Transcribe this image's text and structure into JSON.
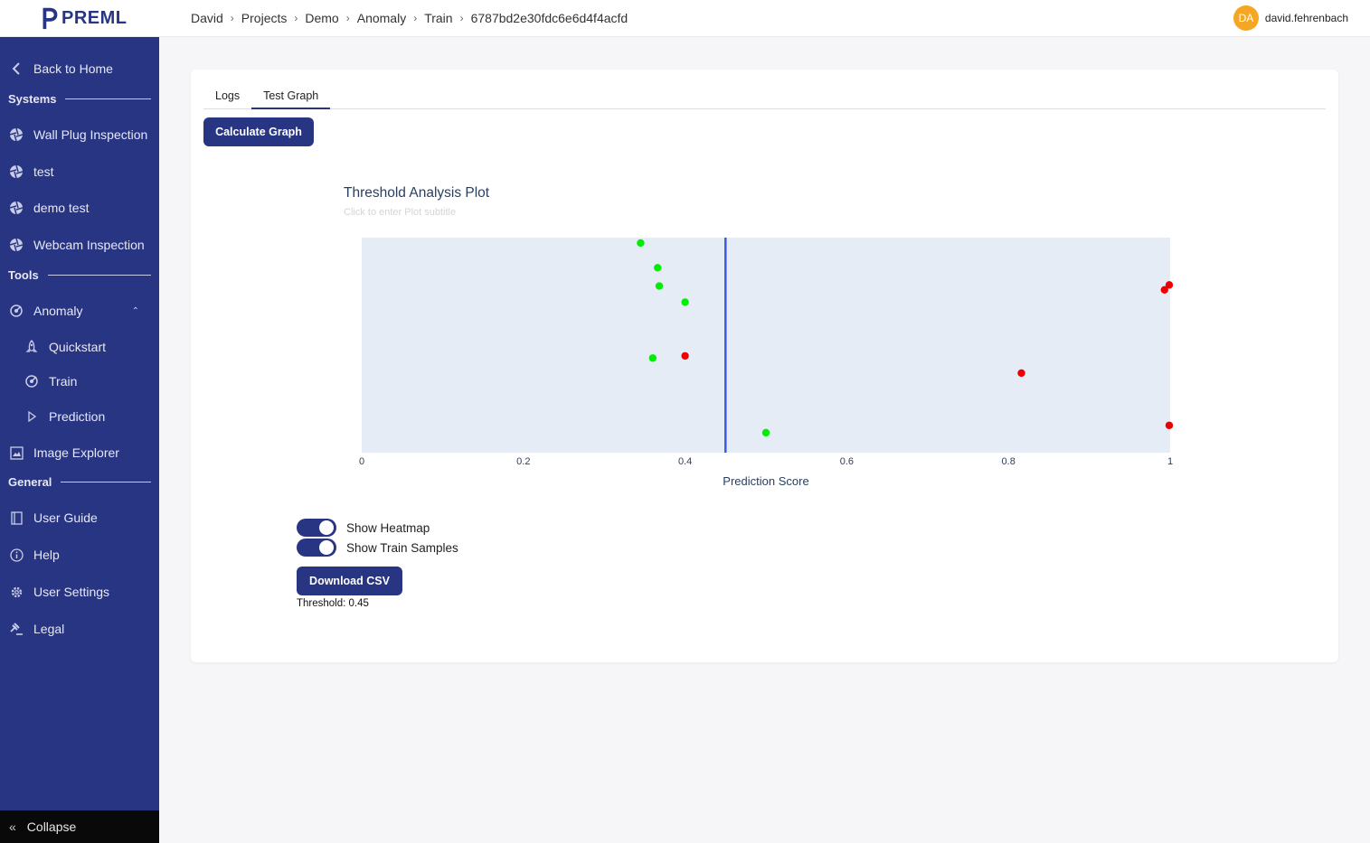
{
  "header": {
    "logo_text": "PREML",
    "breadcrumb": [
      "David",
      "Projects",
      "Demo",
      "Anomaly",
      "Train",
      "6787bd2e30fdc6e6d4f4acfd"
    ],
    "user": {
      "initials": "DA",
      "name": "david.fehrenbach"
    }
  },
  "sidebar": {
    "back": "Back to Home",
    "sections": {
      "systems": "Systems",
      "tools": "Tools",
      "general": "General"
    },
    "systems_items": [
      "Wall Plug Inspection",
      "test",
      "demo test",
      "Webcam Inspection"
    ],
    "tools_items": {
      "anomaly": "Anomaly",
      "quickstart": "Quickstart",
      "train": "Train",
      "prediction": "Prediction",
      "image_explorer": "Image Explorer"
    },
    "general_items": [
      "User Guide",
      "Help",
      "User Settings",
      "Legal"
    ],
    "collapse": "Collapse"
  },
  "main": {
    "tabs": [
      {
        "label": "Logs",
        "active": false
      },
      {
        "label": "Test Graph",
        "active": true
      }
    ],
    "calculate_button": "Calculate Graph",
    "show_heatmap": {
      "label": "Show Heatmap",
      "on": true
    },
    "show_train_samples": {
      "label": "Show Train Samples",
      "on": true
    },
    "download_button": "Download CSV",
    "threshold_text": "Threshold: 0.45"
  },
  "colors": {
    "brand": "#283583",
    "ok": "#00ee00",
    "defect": "#ee0000",
    "threshold_line": "#3a5ed8",
    "plot_bg": "#e5ecf6"
  },
  "chart_data": {
    "type": "scatter",
    "title": "Threshold Analysis Plot",
    "subtitle_placeholder": "Click to enter Plot subtitle",
    "xlabel": "Prediction Score",
    "xlim": [
      0,
      1
    ],
    "x_ticks": [
      "0",
      "0.2",
      "0.4",
      "0.6",
      "0.8",
      "1"
    ],
    "y_axis_visible": false,
    "grid": false,
    "threshold": 0.45,
    "series": [
      {
        "color": "#00ee00",
        "points": [
          {
            "x": 0.345,
            "y": 0.975
          },
          {
            "x": 0.366,
            "y": 0.86
          },
          {
            "x": 0.368,
            "y": 0.775
          },
          {
            "x": 0.4,
            "y": 0.7
          },
          {
            "x": 0.36,
            "y": 0.44
          },
          {
            "x": 0.5,
            "y": 0.093
          }
        ]
      },
      {
        "color": "#ee0000",
        "points": [
          {
            "x": 1.0,
            "y": 0.78
          },
          {
            "x": 0.993,
            "y": 0.757
          },
          {
            "x": 0.4,
            "y": 0.45
          },
          {
            "x": 0.816,
            "y": 0.37
          },
          {
            "x": 1.0,
            "y": 0.127
          }
        ]
      }
    ]
  }
}
